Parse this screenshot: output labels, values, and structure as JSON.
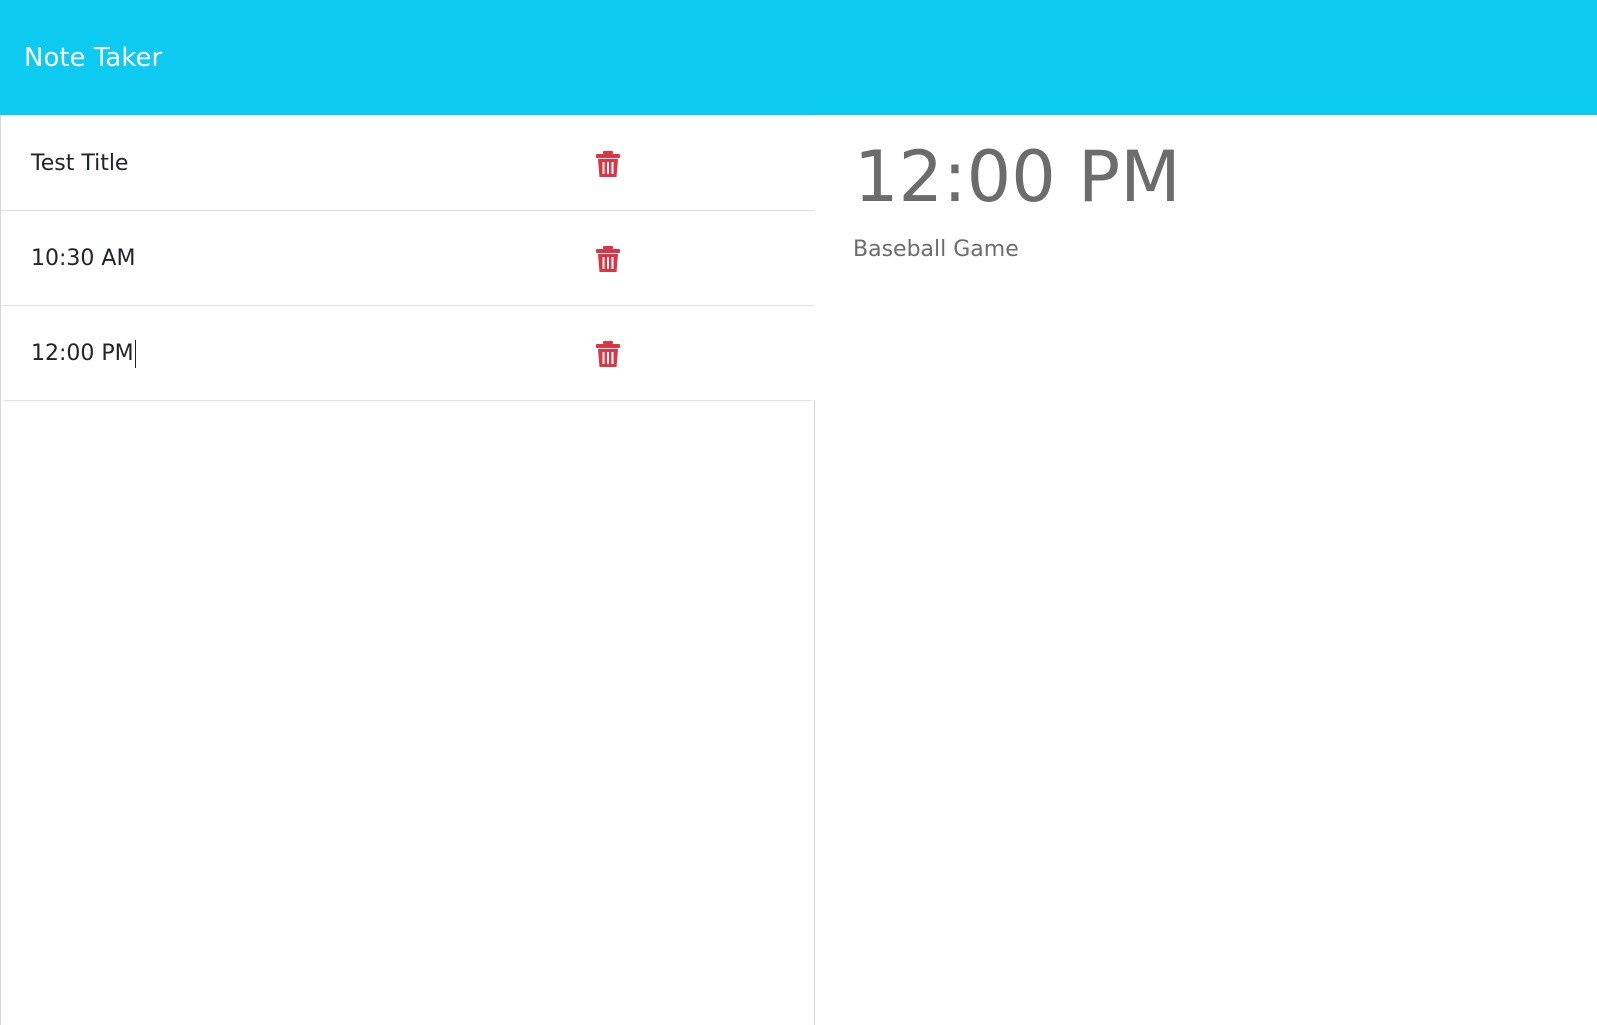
{
  "app": {
    "brand": "Note Taker"
  },
  "notes": [
    {
      "title": "Test Title"
    },
    {
      "title": "10:30 AM"
    },
    {
      "title": "12:00 PM"
    }
  ],
  "active_note": {
    "title": "12:00 PM",
    "text": "Baseball Game"
  },
  "icons": {
    "delete": "trash-icon"
  },
  "colors": {
    "navbar": "#0dcaf0",
    "delete": "#dc3545",
    "muted_text": "#6c6c6c"
  }
}
